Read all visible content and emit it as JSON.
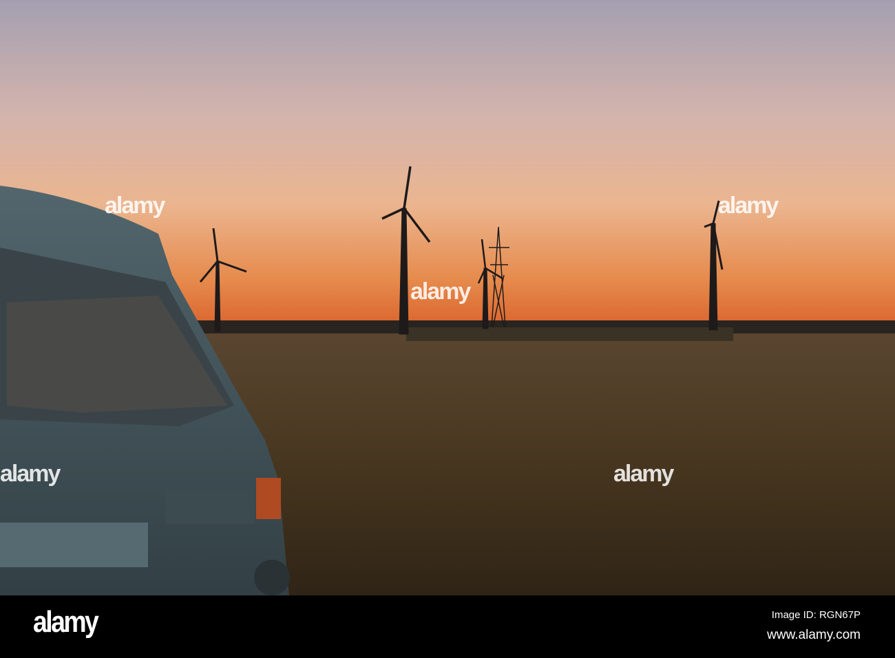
{
  "photo": {
    "subject": "camper van by field with wind turbines at sunset",
    "colors": {
      "sky_top": "#a7a3b3",
      "sky_mid": "#e6b79c",
      "horizon": "#e0743a",
      "field": "#3f3120",
      "van": "#4d6168"
    }
  },
  "watermark": {
    "text": "alamy"
  },
  "footer": {
    "logo": "alamy",
    "image_id": "Image ID: RGN67P",
    "website": "www.alamy.com"
  }
}
